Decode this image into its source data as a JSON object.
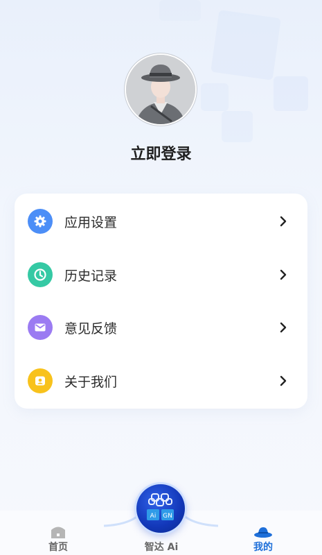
{
  "profile": {
    "login_label": "立即登录"
  },
  "menu": {
    "items": [
      {
        "label": "应用设置",
        "icon": "gear-icon",
        "color": "#4c8ef7"
      },
      {
        "label": "历史记录",
        "icon": "clock-icon",
        "color": "#35c9a4"
      },
      {
        "label": "意见反馈",
        "icon": "mail-icon",
        "color": "#9b7bf2"
      },
      {
        "label": "关于我们",
        "icon": "person-card-icon",
        "color": "#f8c21c"
      }
    ]
  },
  "tabbar": {
    "home_label": "首页",
    "center_label": "智达 Ai",
    "mine_label": "我的",
    "active_color": "#1e6fd9"
  }
}
